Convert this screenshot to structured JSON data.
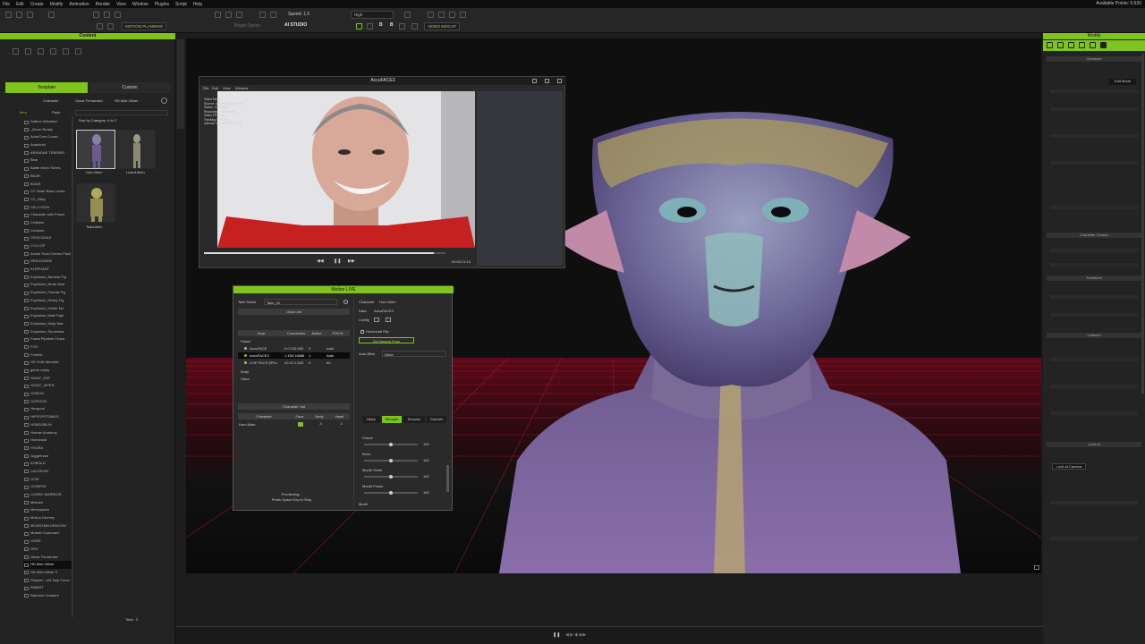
{
  "menubar": {
    "items": [
      "File",
      "Edit",
      "Create",
      "Modify",
      "Animation",
      "Render",
      "View",
      "Window",
      "Plugins",
      "Script",
      "Help"
    ],
    "user": "Available Points: 6,630"
  },
  "toolbar": {
    "speed_label": "Speed: 1.0",
    "quality": "High",
    "motion_planning": "MOTION PLANNING",
    "bright_option": "Bright Option",
    "ai_studio": "AI STUDIO",
    "video_mocap": "VIDEO MOCAP"
  },
  "content_panel": {
    "title": "Content",
    "tabs": [
      "Template",
      "Custom"
    ],
    "breadcrumb": [
      "Character",
      "Oscar Fernandez",
      "HD Alien Mixer"
    ],
    "column_tabs": [
      "Item",
      "Pack"
    ],
    "sort_label": "Sort by Category: A to Z",
    "tree_items": [
      "Saffron Wiserber",
      "_Moon Ready",
      "ActorCore Crowd",
      "Anachnid",
      "ARANDAE TENEBRI",
      "Bear",
      "Battle Mech Series",
      "BEAR",
      "BOAR",
      "CC Nude Base Looks",
      "CC_Alley",
      "CELLYSON",
      "Character with Poses",
      "Civilians",
      "Creature",
      "CROCODILE",
      "CYCLOP",
      "Anime Toon Combo Pack",
      "DRAGONIDE",
      "ELEPHANT",
      "Explosive_Berserk Fig",
      "Explosive_Brute Warr",
      "Explosive_Female Fig",
      "Explosive_Heavy Fig",
      "Explosive_Kesler Mo",
      "Explosive_Male Figh",
      "Explosive_Ninja War",
      "Explosive_Sorceress",
      "Facial Pipeline Chara",
      "FOX",
      "Freebie",
      "G5 Cloth Memetic",
      "game-ready",
      "GIANT_RAT",
      "GIANT_VIPER",
      "GOBLIN",
      "GORGON",
      "Hexapod",
      "HIPPOPOTAMUS",
      "HOBGOBLIN",
      "Human Anatomy",
      "Humanoid",
      "HYDRA",
      "Juggernaut",
      "KOBOLD",
      "LACODON",
      "LION",
      "LIONESS",
      "LIZARD WARRIOR",
      "Mekaim",
      "Mermaplum",
      "Motion Dummy",
      "MOUNTAIN DRAGON",
      "Mutant Cockroach",
      "OGRE",
      "ORC",
      "Oscar Fernandez",
      "HD Alien Mixer",
      "HD Alien Mixer II",
      "Playwei - UN Task Force",
      "RABBIT",
      "Random Creature"
    ],
    "selected_item": "HD Alien Mixer",
    "thumbnails": [
      "Horn Alien",
      "Lizard Alien",
      "Toad Alien"
    ],
    "page_label": "Total : 3"
  },
  "video_window": {
    "title": "AccuFACE3",
    "menu": [
      "File",
      "Edit",
      "View",
      "Window"
    ],
    "overlay_text": "Video Mode\nSource: 480 x 640 @ 30 fps\nStatus: Connected\nResolution: 1920x1080\nVideo FPS: 30\nTracking FPS: 30\nInternal: 40 / 40 / 100 / 100",
    "timecode": "00:00:21:10"
  },
  "motion_live": {
    "title": "Motion LIVE",
    "take_name_label": "Take Name",
    "take_name_value": "Take_01",
    "gear_list_title": "Gear List",
    "gear_headers": [
      "Gear",
      "Connection",
      "Active",
      "FOV/S"
    ],
    "gear_groups": [
      "Facial",
      "Body",
      "Hand"
    ],
    "gear_rows": [
      {
        "name": "AccuFACE",
        "conn": "0.0.100.000",
        "active": "0",
        "fps": "Auto"
      },
      {
        "name": "AccuFACE3",
        "conn": "1.159.14686",
        "active": "1",
        "fps": "Auto"
      },
      {
        "name": "LIVE FACE (iPho",
        "conn": "20.10.1.000",
        "active": "0",
        "fps": "60"
      }
    ],
    "character_list_title": "Character List",
    "char_headers": [
      "Character",
      "Face",
      "Body",
      "Hand"
    ],
    "char_row": "Horn Alien",
    "preview_line1": "Previewing...",
    "preview_line2": "Press Space Key to Stop",
    "character_label": "Character",
    "character_value": "Horn Alien",
    "data_label": "Data",
    "data_value": "AccuFACE3",
    "config_label": "Config",
    "horizontal_flip": "Horizontal Flip",
    "set_neutral": "Set Neutral Pose",
    "auto_blink_label": "Auto-Blink",
    "auto_blink_value": "None",
    "tabs": [
      "Mask",
      "Strength",
      "Denoise",
      "Smooth"
    ],
    "sliders": [
      {
        "label": "Cheek",
        "value": "100"
      },
      {
        "label": "Brow",
        "value": "100"
      },
      {
        "label": "Mouth Smile",
        "value": "100"
      },
      {
        "label": "Mouth Frown",
        "value": "100"
      }
    ],
    "mode_label": "Mode"
  },
  "right_panel": {
    "title": "Modify",
    "sections": [
      "Character",
      "Character Creator",
      "Transform",
      "Collision",
      "Look at"
    ],
    "edit_mode": "Edit Mode",
    "look_at_camera": "Look at Camera"
  }
}
